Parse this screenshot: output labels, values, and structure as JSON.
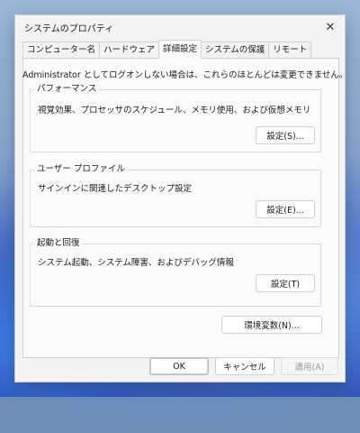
{
  "window": {
    "title": "システムのプロパティ",
    "close_glyph": "✕"
  },
  "tabs": [
    {
      "label": "コンピューター名",
      "active": false
    },
    {
      "label": "ハードウェア",
      "active": false
    },
    {
      "label": "詳細設定",
      "active": true
    },
    {
      "label": "システムの保護",
      "active": false
    },
    {
      "label": "リモート",
      "active": false
    }
  ],
  "advanced": {
    "info": "Administrator としてログオンしない場合は、これらのほとんどは変更できません。",
    "performance": {
      "title": "パフォーマンス",
      "description": "視覚効果、プロセッサのスケジュール、メモリ使用、および仮想メモリ",
      "button": "設定(S)..."
    },
    "user_profile": {
      "title": "ユーザー プロファイル",
      "description": "サインインに関連したデスクトップ設定",
      "button": "設定(E)..."
    },
    "startup": {
      "title": "起動と回復",
      "description": "システム起動、システム障害、およびデバッグ情報",
      "button": "設定(T)"
    },
    "env_button": "環境変数(N)..."
  },
  "footer": {
    "ok": "OK",
    "cancel": "キャンセル",
    "apply": "適用(A)"
  }
}
